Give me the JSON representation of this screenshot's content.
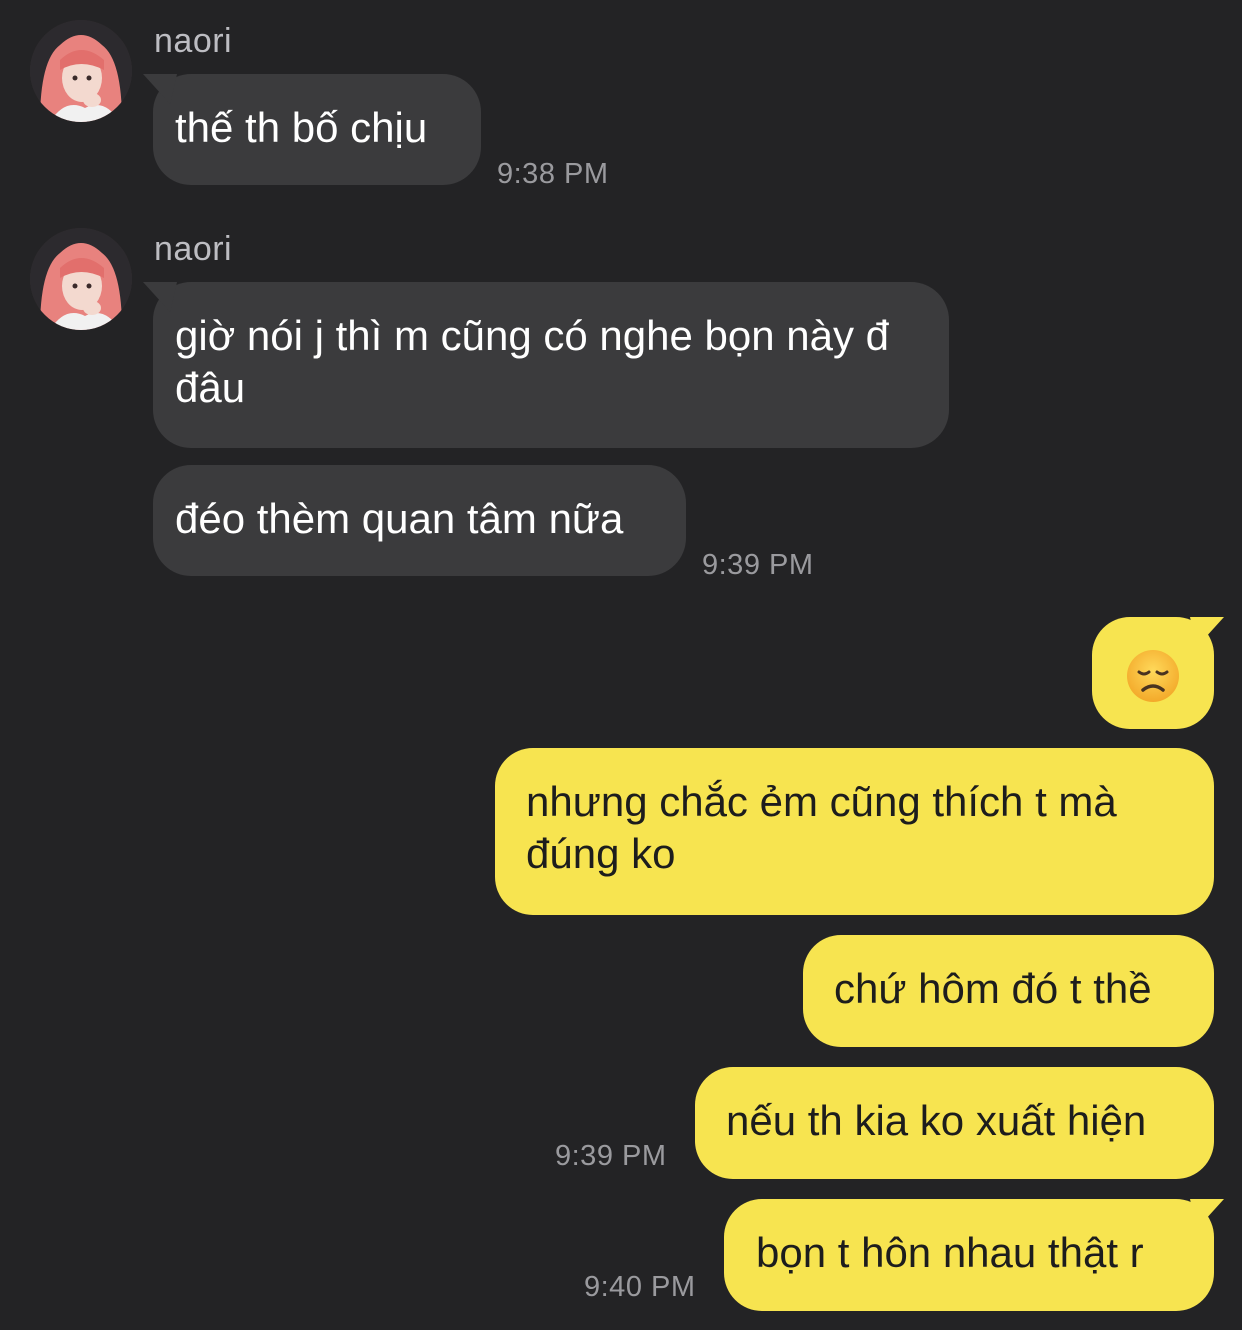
{
  "contact": {
    "name": "naori"
  },
  "groups": [
    {
      "sender": "naori",
      "messages": [
        "thế th bố chịu"
      ],
      "time": "9:38 PM"
    },
    {
      "sender": "naori",
      "messages": [
        "giờ nói j thì m cũng có nghe bọn này đ đâu",
        "đéo thèm quan tâm nữa"
      ],
      "time": "9:39 PM"
    }
  ],
  "outgoing": {
    "emoji": "disappointed-face",
    "messages": [
      "nhưng chắc ẻm cũng thích t mà đúng ko",
      "chứ hôm đó t thề",
      "nếu th kia ko xuất hiện"
    ],
    "time": "9:39 PM",
    "last_message": "bọn t hôn nhau thật r",
    "last_time": "9:40 PM"
  },
  "colors": {
    "background": "#232325",
    "incoming_bubble": "#3b3b3d",
    "outgoing_bubble": "#f7e450"
  }
}
